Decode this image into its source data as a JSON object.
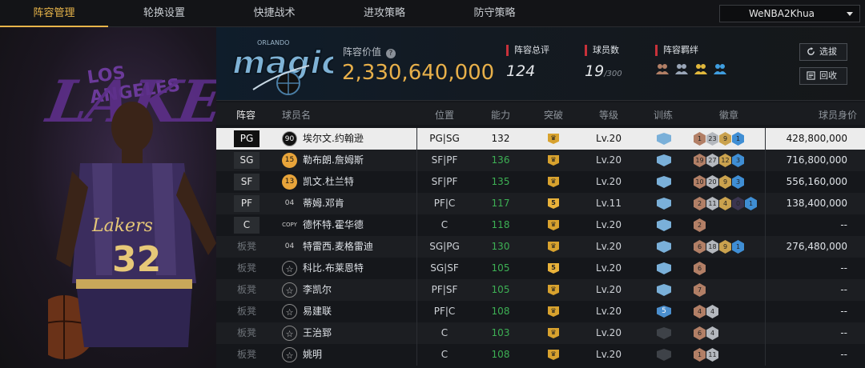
{
  "nav": {
    "tabs": [
      "阵容管理",
      "轮换设置",
      "快捷战术",
      "进攻策略",
      "防守策略"
    ],
    "active": 0,
    "account": "WeNBA2Khua"
  },
  "team": {
    "logo_text": "magic",
    "logo_top_text": "ORLANDO",
    "value_label": "阵容价值",
    "value": "2,330,640,000",
    "stats": [
      {
        "label": "阵容总评",
        "value": "124",
        "suffix": ""
      },
      {
        "label": "球员数",
        "value": "19",
        "suffix": "/300"
      },
      {
        "label": "阵容羁绊",
        "value": "",
        "suffix": ""
      }
    ],
    "buttons": [
      {
        "label": "选拔",
        "icon": "refresh-icon"
      },
      {
        "label": "回收",
        "icon": "recycle-icon"
      }
    ]
  },
  "featured": {
    "team_word": "LAKERS",
    "city": "LOS ANGELES",
    "jersey": "32"
  },
  "colors": {
    "accent": "#e8b54a",
    "ability_green": "#3db054",
    "red_marker": "#c8313a"
  },
  "table": {
    "headers": [
      "阵容",
      "球员名",
      "位置",
      "能力",
      "突破",
      "等级",
      "训练",
      "徽章",
      "球员身价"
    ],
    "rows": [
      {
        "slot": "PG",
        "ovr": "90",
        "name": "埃尔文.约翰逊",
        "pos": "PG|SG",
        "ability": "132",
        "breakthrough": "",
        "level": "Lv.20",
        "train": "",
        "badges": [
          [
            "b",
            "1"
          ],
          [
            "s",
            "23"
          ],
          [
            "g",
            "9"
          ],
          [
            "h",
            "1"
          ]
        ],
        "price": "428,800,000",
        "selected": true
      },
      {
        "slot": "SG",
        "ovr": "15",
        "name": "勒布朗.詹姆斯",
        "pos": "SF|PF",
        "ability": "136",
        "breakthrough": "",
        "level": "Lv.20",
        "train": "",
        "badges": [
          [
            "b",
            "19"
          ],
          [
            "s",
            "27"
          ],
          [
            "g",
            "12"
          ],
          [
            "h",
            "3"
          ]
        ],
        "price": "716,800,000"
      },
      {
        "slot": "SF",
        "ovr": "13",
        "name": "凯文.杜兰特",
        "pos": "SF|PF",
        "ability": "135",
        "breakthrough": "",
        "level": "Lv.20",
        "train": "",
        "badges": [
          [
            "b",
            "10"
          ],
          [
            "s",
            "20"
          ],
          [
            "g",
            "9"
          ],
          [
            "h",
            "3"
          ]
        ],
        "price": "556,160,000"
      },
      {
        "slot": "PF",
        "ovr": "04",
        "name": "蒂姆.邓肯",
        "pos": "PF|C",
        "ability": "117",
        "breakthrough": "5",
        "level": "Lv.11",
        "train": "",
        "badges": [
          [
            "b",
            "2"
          ],
          [
            "s",
            "11"
          ],
          [
            "g",
            "4"
          ],
          [
            "d",
            "0"
          ],
          [
            "h",
            "1"
          ]
        ],
        "price": "138,400,000"
      },
      {
        "slot": "C",
        "ovr": "COPY",
        "name": "德怀特.霍华德",
        "pos": "C",
        "ability": "118",
        "breakthrough": "",
        "level": "Lv.20",
        "train": "",
        "badges": [
          [
            "b",
            "2"
          ]
        ],
        "price": "--"
      },
      {
        "slot": "板凳",
        "ovr": "04",
        "name": "特雷西.麦格雷迪",
        "pos": "SG|PG",
        "ability": "130",
        "breakthrough": "",
        "level": "Lv.20",
        "train": "",
        "badges": [
          [
            "b",
            "6"
          ],
          [
            "s",
            "18"
          ],
          [
            "g",
            "9"
          ],
          [
            "h",
            "1"
          ]
        ],
        "price": "276,480,000"
      },
      {
        "slot": "板凳",
        "ovr": "",
        "name": "科比.布莱恩特",
        "pos": "SG|SF",
        "ability": "105",
        "breakthrough": "5",
        "level": "Lv.20",
        "train": "",
        "badges": [
          [
            "b",
            "6"
          ]
        ],
        "price": "--"
      },
      {
        "slot": "板凳",
        "ovr": "",
        "name": "李凯尔",
        "pos": "PF|SF",
        "ability": "105",
        "breakthrough": "",
        "level": "Lv.20",
        "train": "",
        "badges": [
          [
            "b",
            "7"
          ]
        ],
        "price": "--"
      },
      {
        "slot": "板凳",
        "ovr": "",
        "name": "易建联",
        "pos": "PF|C",
        "ability": "108",
        "breakthrough": "",
        "level": "Lv.20",
        "train": "5",
        "badges": [
          [
            "b",
            "4"
          ],
          [
            "s",
            "4"
          ]
        ],
        "price": "--"
      },
      {
        "slot": "板凳",
        "ovr": "",
        "name": "王治郅",
        "pos": "C",
        "ability": "103",
        "breakthrough": "",
        "level": "Lv.20",
        "train": "dim",
        "badges": [
          [
            "b",
            "6"
          ],
          [
            "s",
            "4"
          ]
        ],
        "price": "--"
      },
      {
        "slot": "板凳",
        "ovr": "",
        "name": "姚明",
        "pos": "C",
        "ability": "108",
        "breakthrough": "",
        "level": "Lv.20",
        "train": "dim",
        "badges": [
          [
            "b",
            "1"
          ],
          [
            "s",
            "11"
          ]
        ],
        "price": "--"
      }
    ]
  }
}
